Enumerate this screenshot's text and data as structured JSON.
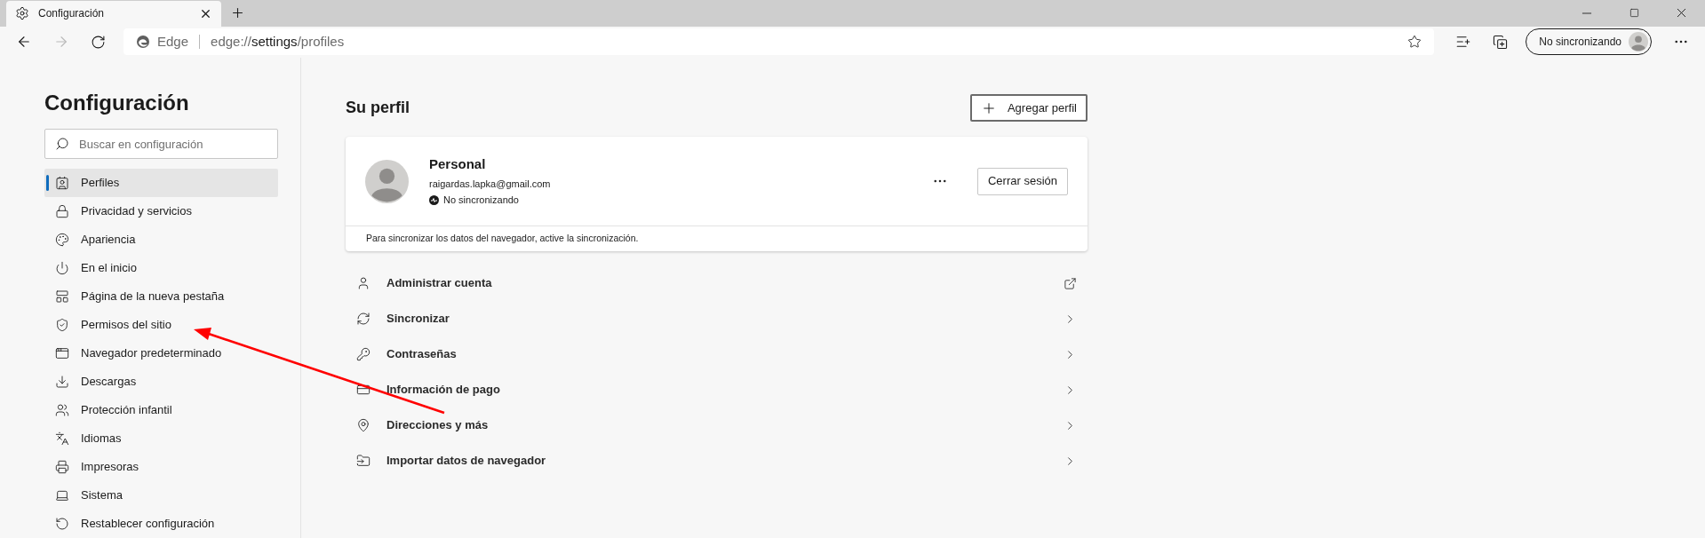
{
  "tab": {
    "title": "Configuración"
  },
  "address": {
    "brand": "Edge",
    "url_scheme": "edge://",
    "url_host": "settings",
    "url_path": "/profiles"
  },
  "profile_button": {
    "label": "No sincronizando"
  },
  "sidebar": {
    "title": "Configuración",
    "search": {
      "placeholder": "Buscar en configuración"
    },
    "items": [
      {
        "label": "Perfiles",
        "selected": true
      },
      {
        "label": "Privacidad y servicios",
        "selected": false
      },
      {
        "label": "Apariencia",
        "selected": false
      },
      {
        "label": "En el inicio",
        "selected": false
      },
      {
        "label": "Página de la nueva pestaña",
        "selected": false
      },
      {
        "label": "Permisos del sitio",
        "selected": false
      },
      {
        "label": "Navegador predeterminado",
        "selected": false
      },
      {
        "label": "Descargas",
        "selected": false
      },
      {
        "label": "Protección infantil",
        "selected": false
      },
      {
        "label": "Idiomas",
        "selected": false
      },
      {
        "label": "Impresoras",
        "selected": false
      },
      {
        "label": "Sistema",
        "selected": false
      },
      {
        "label": "Restablecer configuración",
        "selected": false
      }
    ]
  },
  "content": {
    "heading": "Su perfil",
    "add_button": "Agregar perfil",
    "card": {
      "name": "Personal",
      "email": "raigardas.lapka@gmail.com",
      "sync_status": "No sincronizando",
      "signout_button": "Cerrar sesión",
      "note": "Para sincronizar los datos del navegador, active la sincronización."
    },
    "rows": [
      {
        "label": "Administrar cuenta",
        "kind": "external"
      },
      {
        "label": "Sincronizar",
        "kind": "chevron"
      },
      {
        "label": "Contraseñas",
        "kind": "chevron"
      },
      {
        "label": "Información de pago",
        "kind": "chevron"
      },
      {
        "label": "Direcciones y más",
        "kind": "chevron"
      },
      {
        "label": "Importar datos de navegador",
        "kind": "chevron"
      }
    ]
  }
}
